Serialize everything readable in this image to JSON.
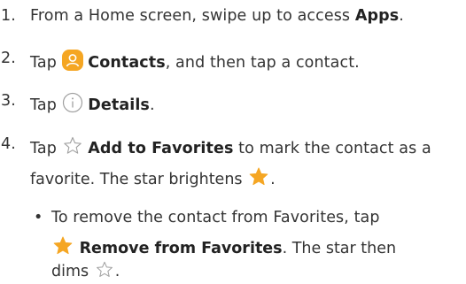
{
  "steps": [
    {
      "num": "1.",
      "pre": "From a Home screen, swipe up to access ",
      "bold": "Apps",
      "post": "."
    },
    {
      "num": "2.",
      "pre": "Tap ",
      "icon": "contacts-icon",
      "bold": "Contacts",
      "post": ", and then tap a contact."
    },
    {
      "num": "3.",
      "pre": "Tap ",
      "icon": "info-icon",
      "bold": "Details",
      "post": "."
    },
    {
      "num": "4.",
      "pre": "Tap ",
      "icon": "star-outline-icon",
      "bold": "Add to Favorites",
      "post": " to mark the contact as a",
      "line2_pre": "favorite. The star brightens ",
      "line2_icon": "star-filled-icon",
      "line2_post": "."
    }
  ],
  "bullet": {
    "dot": "•",
    "line1": "To remove the contact from Favorites, tap",
    "line2_icon": "star-filled-icon",
    "line2_bold": "Remove from Favorites",
    "line2_post": ". The star then",
    "line3_pre": "dims ",
    "line3_icon": "star-outline-icon",
    "line3_post": "."
  },
  "colors": {
    "contacts_icon": "#f5a623",
    "star_filled": "#f5a623",
    "text": "#333333",
    "outline": "#a0a0a0"
  }
}
